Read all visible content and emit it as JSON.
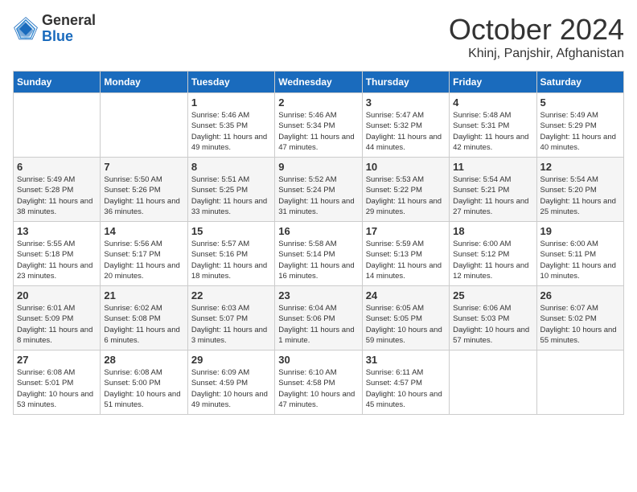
{
  "header": {
    "logo_general": "General",
    "logo_blue": "Blue",
    "title": "October 2024",
    "location": "Khinj, Panjshir, Afghanistan"
  },
  "days_of_week": [
    "Sunday",
    "Monday",
    "Tuesday",
    "Wednesday",
    "Thursday",
    "Friday",
    "Saturday"
  ],
  "weeks": [
    [
      {
        "day": "",
        "info": ""
      },
      {
        "day": "",
        "info": ""
      },
      {
        "day": "1",
        "info": "Sunrise: 5:46 AM\nSunset: 5:35 PM\nDaylight: 11 hours and 49 minutes."
      },
      {
        "day": "2",
        "info": "Sunrise: 5:46 AM\nSunset: 5:34 PM\nDaylight: 11 hours and 47 minutes."
      },
      {
        "day": "3",
        "info": "Sunrise: 5:47 AM\nSunset: 5:32 PM\nDaylight: 11 hours and 44 minutes."
      },
      {
        "day": "4",
        "info": "Sunrise: 5:48 AM\nSunset: 5:31 PM\nDaylight: 11 hours and 42 minutes."
      },
      {
        "day": "5",
        "info": "Sunrise: 5:49 AM\nSunset: 5:29 PM\nDaylight: 11 hours and 40 minutes."
      }
    ],
    [
      {
        "day": "6",
        "info": "Sunrise: 5:49 AM\nSunset: 5:28 PM\nDaylight: 11 hours and 38 minutes."
      },
      {
        "day": "7",
        "info": "Sunrise: 5:50 AM\nSunset: 5:26 PM\nDaylight: 11 hours and 36 minutes."
      },
      {
        "day": "8",
        "info": "Sunrise: 5:51 AM\nSunset: 5:25 PM\nDaylight: 11 hours and 33 minutes."
      },
      {
        "day": "9",
        "info": "Sunrise: 5:52 AM\nSunset: 5:24 PM\nDaylight: 11 hours and 31 minutes."
      },
      {
        "day": "10",
        "info": "Sunrise: 5:53 AM\nSunset: 5:22 PM\nDaylight: 11 hours and 29 minutes."
      },
      {
        "day": "11",
        "info": "Sunrise: 5:54 AM\nSunset: 5:21 PM\nDaylight: 11 hours and 27 minutes."
      },
      {
        "day": "12",
        "info": "Sunrise: 5:54 AM\nSunset: 5:20 PM\nDaylight: 11 hours and 25 minutes."
      }
    ],
    [
      {
        "day": "13",
        "info": "Sunrise: 5:55 AM\nSunset: 5:18 PM\nDaylight: 11 hours and 23 minutes."
      },
      {
        "day": "14",
        "info": "Sunrise: 5:56 AM\nSunset: 5:17 PM\nDaylight: 11 hours and 20 minutes."
      },
      {
        "day": "15",
        "info": "Sunrise: 5:57 AM\nSunset: 5:16 PM\nDaylight: 11 hours and 18 minutes."
      },
      {
        "day": "16",
        "info": "Sunrise: 5:58 AM\nSunset: 5:14 PM\nDaylight: 11 hours and 16 minutes."
      },
      {
        "day": "17",
        "info": "Sunrise: 5:59 AM\nSunset: 5:13 PM\nDaylight: 11 hours and 14 minutes."
      },
      {
        "day": "18",
        "info": "Sunrise: 6:00 AM\nSunset: 5:12 PM\nDaylight: 11 hours and 12 minutes."
      },
      {
        "day": "19",
        "info": "Sunrise: 6:00 AM\nSunset: 5:11 PM\nDaylight: 11 hours and 10 minutes."
      }
    ],
    [
      {
        "day": "20",
        "info": "Sunrise: 6:01 AM\nSunset: 5:09 PM\nDaylight: 11 hours and 8 minutes."
      },
      {
        "day": "21",
        "info": "Sunrise: 6:02 AM\nSunset: 5:08 PM\nDaylight: 11 hours and 6 minutes."
      },
      {
        "day": "22",
        "info": "Sunrise: 6:03 AM\nSunset: 5:07 PM\nDaylight: 11 hours and 3 minutes."
      },
      {
        "day": "23",
        "info": "Sunrise: 6:04 AM\nSunset: 5:06 PM\nDaylight: 11 hours and 1 minute."
      },
      {
        "day": "24",
        "info": "Sunrise: 6:05 AM\nSunset: 5:05 PM\nDaylight: 10 hours and 59 minutes."
      },
      {
        "day": "25",
        "info": "Sunrise: 6:06 AM\nSunset: 5:03 PM\nDaylight: 10 hours and 57 minutes."
      },
      {
        "day": "26",
        "info": "Sunrise: 6:07 AM\nSunset: 5:02 PM\nDaylight: 10 hours and 55 minutes."
      }
    ],
    [
      {
        "day": "27",
        "info": "Sunrise: 6:08 AM\nSunset: 5:01 PM\nDaylight: 10 hours and 53 minutes."
      },
      {
        "day": "28",
        "info": "Sunrise: 6:08 AM\nSunset: 5:00 PM\nDaylight: 10 hours and 51 minutes."
      },
      {
        "day": "29",
        "info": "Sunrise: 6:09 AM\nSunset: 4:59 PM\nDaylight: 10 hours and 49 minutes."
      },
      {
        "day": "30",
        "info": "Sunrise: 6:10 AM\nSunset: 4:58 PM\nDaylight: 10 hours and 47 minutes."
      },
      {
        "day": "31",
        "info": "Sunrise: 6:11 AM\nSunset: 4:57 PM\nDaylight: 10 hours and 45 minutes."
      },
      {
        "day": "",
        "info": ""
      },
      {
        "day": "",
        "info": ""
      }
    ]
  ]
}
